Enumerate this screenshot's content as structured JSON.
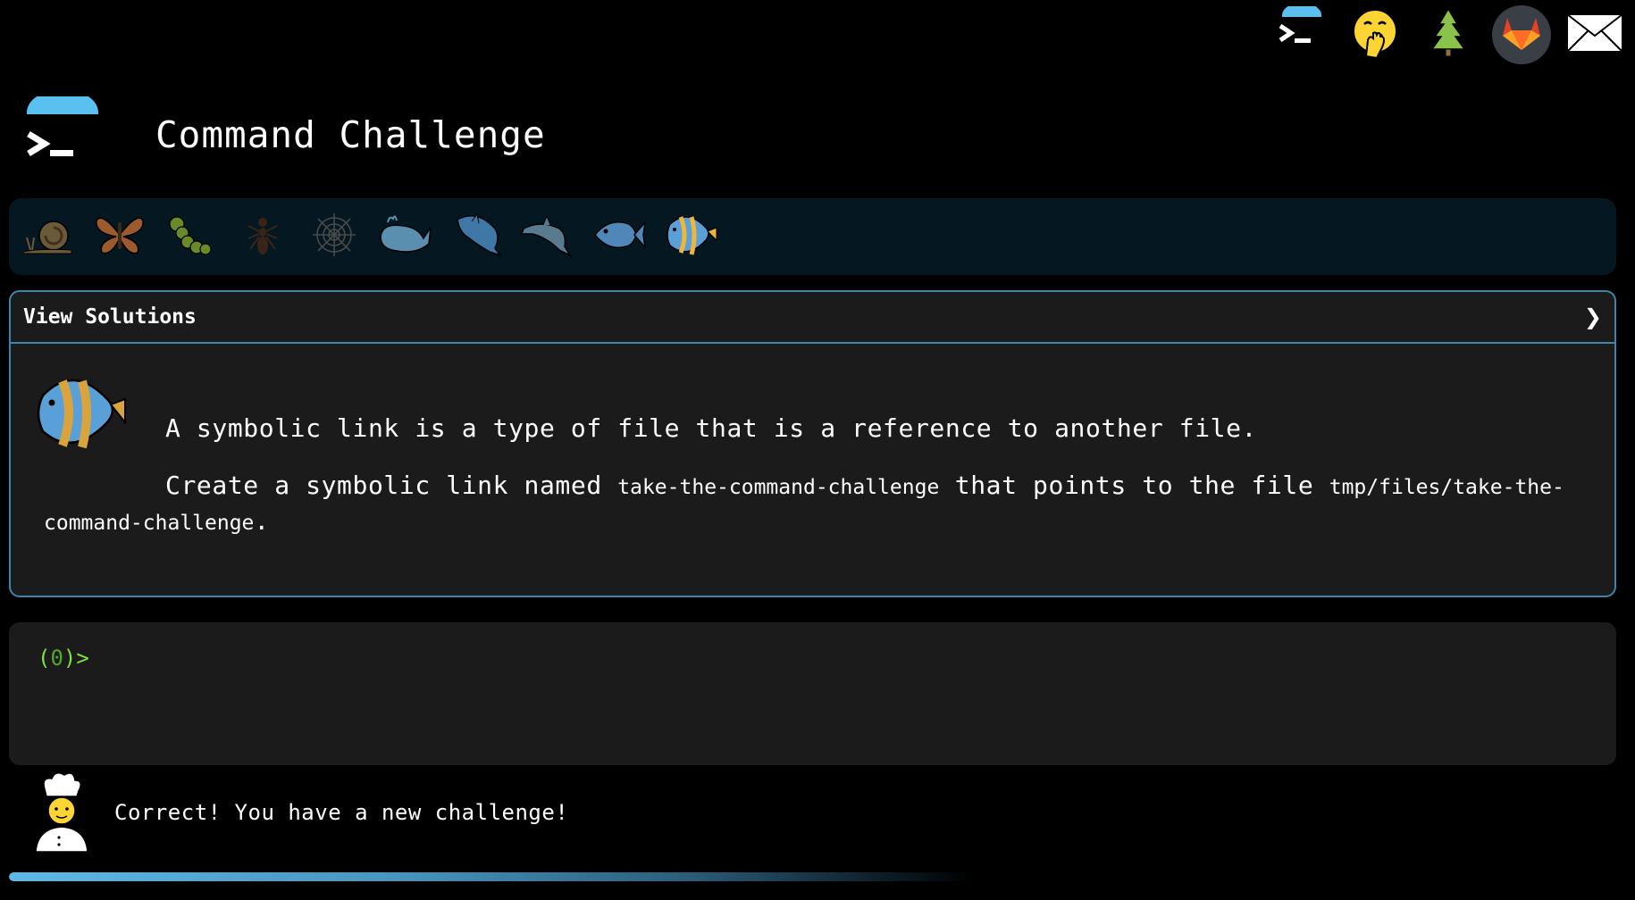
{
  "app": {
    "title": "Command Challenge"
  },
  "topnav": {
    "items": [
      {
        "name": "terminal-logo-icon",
        "label": "terminal"
      },
      {
        "name": "face-with-hand-over-mouth-icon",
        "label": "hint"
      },
      {
        "name": "tree-icon",
        "label": "tree"
      },
      {
        "name": "gitlab-icon",
        "label": "gitlab"
      },
      {
        "name": "envelope-icon",
        "label": "mail"
      }
    ]
  },
  "levels": [
    {
      "name": "snail-icon",
      "completed": true
    },
    {
      "name": "butterfly-icon",
      "completed": true
    },
    {
      "name": "caterpillar-icon",
      "completed": true
    },
    {
      "name": "ant-icon",
      "completed": true
    },
    {
      "name": "spider-web-icon",
      "completed": true
    },
    {
      "name": "whale-icon",
      "completed": true
    },
    {
      "name": "dolphin-icon",
      "completed": true
    },
    {
      "name": "dolphin-2-icon",
      "completed": true
    },
    {
      "name": "fish-icon",
      "completed": true
    },
    {
      "name": "tropical-fish-icon",
      "completed": false,
      "current": true
    }
  ],
  "panel": {
    "header_label": "View Solutions",
    "chevron": "❯",
    "description_line1": "A symbolic link is a type of file that is a reference to another file.",
    "description_line2_prefix": "Create a symbolic link named ",
    "link_name": "take-the-command-challenge",
    "description_line2_middle": " that points to the file ",
    "target_path": "tmp/files/take-the-command-challenge",
    "description_line2_suffix": "."
  },
  "terminal": {
    "prompt_open": "(",
    "prompt_count": "0",
    "prompt_close": ")>"
  },
  "status": {
    "message": "Correct! You have a new challenge!"
  },
  "progress": {
    "fraction": 0.6
  },
  "colors": {
    "background": "#000000",
    "panel_bg": "#1b1b1b",
    "panel_border": "#3b86ad",
    "strip_bg": "#051720",
    "prompt_green": "#7ee33c",
    "accent_blue": "#5fb8e6"
  }
}
